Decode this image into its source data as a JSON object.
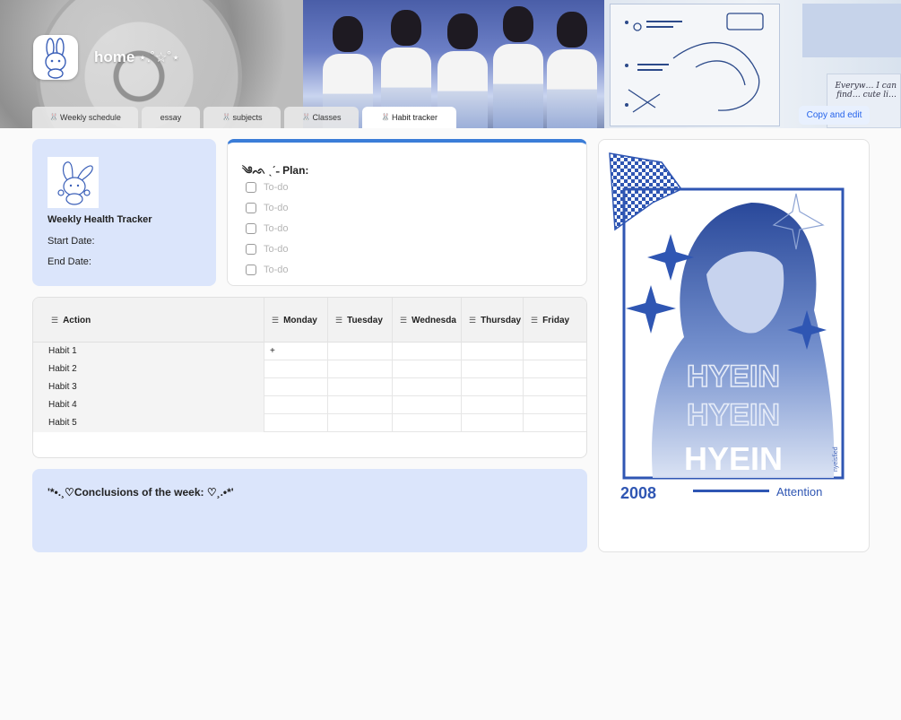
{
  "header": {
    "title": "home",
    "title_deco": "⋆.˚☆˚⋆",
    "tabs": [
      {
        "label": "Weekly schedule",
        "icon": "🐰"
      },
      {
        "label": "essay",
        "icon": ""
      },
      {
        "label": "subjects",
        "icon": "🐰"
      },
      {
        "label": "Classes",
        "icon": "🐰"
      },
      {
        "label": "Habit tracker",
        "icon": "🐰"
      }
    ],
    "copy_button": "Copy and edit",
    "sticker_note": "Everyw… I can find… cute li…"
  },
  "info_card": {
    "title": "Weekly Health Tracker",
    "start_label": "Start Date:",
    "end_label": "End Date:"
  },
  "plan": {
    "title": "༄ᨒ ˎˊ˗ Plan:",
    "todos": [
      {
        "label": "To-do",
        "checked": false
      },
      {
        "label": "To-do",
        "checked": false
      },
      {
        "label": "To-do",
        "checked": false
      },
      {
        "label": "To-do",
        "checked": false
      },
      {
        "label": "To-do",
        "checked": false
      }
    ]
  },
  "habit_table": {
    "columns": [
      "Action",
      "Monday",
      "Tuesday",
      "Wednesda",
      "Thursday",
      "Friday"
    ],
    "rows": [
      {
        "label": "Habit 1",
        "monday": "+"
      },
      {
        "label": "Habit 2",
        "monday": ""
      },
      {
        "label": "Habit 3",
        "monday": ""
      },
      {
        "label": "Habit 4",
        "monday": ""
      },
      {
        "label": "Habit 5",
        "monday": ""
      }
    ]
  },
  "conclusions": {
    "title": "'*•.¸♡Conclusions of the week: ♡¸.•*'"
  },
  "artwork": {
    "name_repeat": "HYEIN",
    "name_main": "HYEIN",
    "year": "2008",
    "caption": "Attention",
    "credit": "nyeisfied",
    "accent_color": "#2f56b3"
  }
}
